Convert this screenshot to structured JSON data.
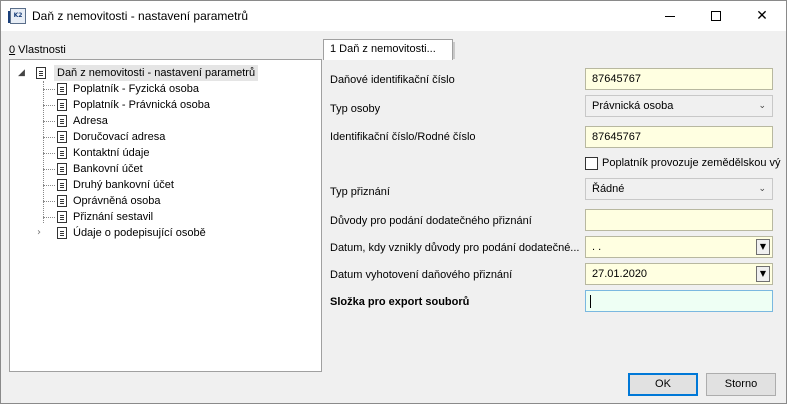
{
  "window": {
    "title": "Daň z nemovitosti - nastavení parametrů",
    "icon_text": "K2"
  },
  "left_panel": {
    "label_prefix": "0",
    "label_rest": " Vlastnosti",
    "tree": {
      "root_label": "Daň z nemovitosti - nastavení parametrů",
      "items": [
        {
          "label": "Poplatník - Fyzická osoba"
        },
        {
          "label": "Poplatník - Právnická osoba"
        },
        {
          "label": "Adresa"
        },
        {
          "label": "Doručovací adresa"
        },
        {
          "label": "Kontaktní údaje"
        },
        {
          "label": "Bankovní účet"
        },
        {
          "label": "Druhý bankovní účet"
        },
        {
          "label": "Oprávněná osoba"
        },
        {
          "label": "Přiznání sestavil"
        },
        {
          "label": "Údaje o podepisující osobě"
        }
      ]
    }
  },
  "tab": {
    "label": "1 Daň z nemovitosti..."
  },
  "form": {
    "dic_label": "Daňové identifikační číslo",
    "dic_value": "87645767",
    "person_type_label": "Typ osoby",
    "person_type_value": "Právnická osoba",
    "ic_label": "Identifikační číslo/Rodné číslo",
    "ic_value": "87645767",
    "farm_checkbox_label": "Poplatník provozuje zemědělskou vý",
    "return_type_label": "Typ přiznání",
    "return_type_value": "Řádné",
    "reasons_label": "Důvody pro podání dodatečného přiznání",
    "reasons_value": "",
    "reasons_date_label": "Datum, kdy vznikly důvody pro podání dodatečné...",
    "reasons_date_value": " .  .",
    "prep_date_label": "Datum vyhotovení daňového přiznání",
    "prep_date_value": "27.01.2020",
    "export_folder_label": "Složka pro export souborů",
    "export_folder_value": ""
  },
  "buttons": {
    "ok": "OK",
    "cancel": "Storno"
  },
  "colors": {
    "input_bg": "#ffffe1",
    "active_input_bg": "#eefff4",
    "accent": "#0078d7"
  }
}
